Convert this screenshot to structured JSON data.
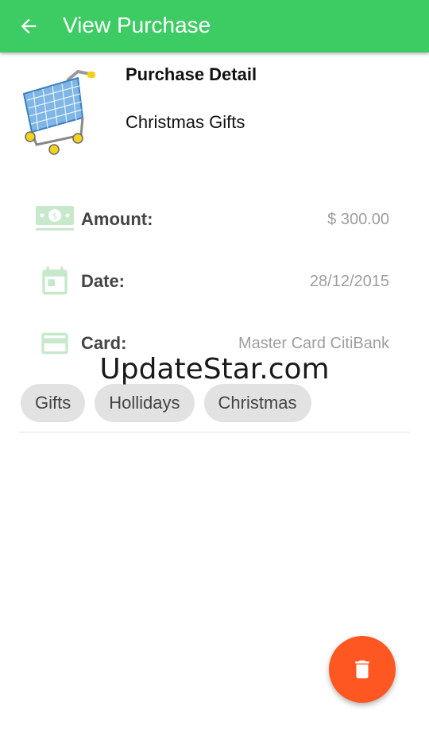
{
  "header": {
    "title": "View Purchase",
    "back_icon": "arrow-back-icon",
    "background_color": "#3ccc63"
  },
  "purchase": {
    "section_title": "Purchase Detail",
    "name": "Christmas Gifts",
    "image_icon": "shopping-cart-icon"
  },
  "details": {
    "amount": {
      "label": "Amount:",
      "value": "$ 300.00",
      "icon": "money-icon"
    },
    "date": {
      "label": "Date:",
      "value": "28/12/2015",
      "icon": "calendar-icon"
    },
    "card": {
      "label": "Card:",
      "value": "Master Card CitiBank",
      "icon": "credit-card-icon"
    }
  },
  "tags": [
    "Gifts",
    "Hollidays",
    "Christmas"
  ],
  "watermark": "UpdateStar.com",
  "fab": {
    "icon": "delete-icon",
    "color": "#ff5722"
  },
  "colors": {
    "icon_tint": "#c8e8cc",
    "label": "#444444",
    "value": "#9e9e9e"
  }
}
